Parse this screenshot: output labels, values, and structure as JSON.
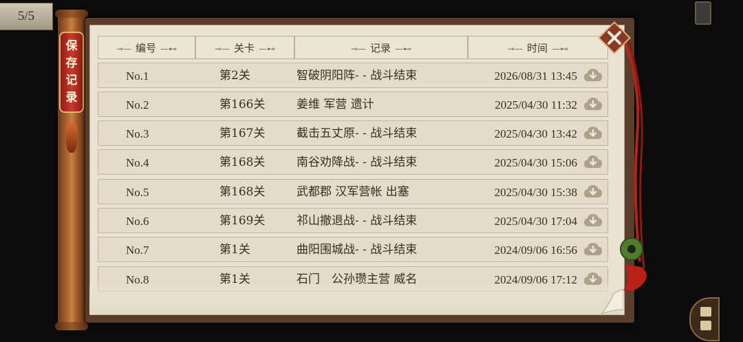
{
  "page_counter": "5/5",
  "side_tab": {
    "chars": [
      "保",
      "存",
      "记",
      "录"
    ]
  },
  "table": {
    "headers": {
      "no": "编号",
      "stage": "关卡",
      "record": "记录",
      "time": "时间"
    },
    "header_ornament_left": "⊸—",
    "header_ornament_right": "—⊷",
    "rows": [
      {
        "no": "No.1",
        "stage": "第2关",
        "record": "智破阴阳阵- - 战斗结束",
        "time": "2026/08/31 13:45"
      },
      {
        "no": "No.2",
        "stage": "第166关",
        "record": "姜维 军营 遗计",
        "time": "2025/04/30 11:32"
      },
      {
        "no": "No.3",
        "stage": "第167关",
        "record": "截击五丈原- - 战斗结束",
        "time": "2025/04/30 13:42"
      },
      {
        "no": "No.4",
        "stage": "第168关",
        "record": "南谷劝降战- - 战斗结束",
        "time": "2025/04/30 15:06"
      },
      {
        "no": "No.5",
        "stage": "第168关",
        "record": "武都郡 汉军营帐 出塞",
        "time": "2025/04/30 15:38"
      },
      {
        "no": "No.6",
        "stage": "第169关",
        "record": "祁山撤退战- - 战斗结束",
        "time": "2025/04/30 17:04"
      },
      {
        "no": "No.7",
        "stage": "第1关",
        "record": "曲阳围城战- - 战斗结束",
        "time": "2024/09/06 16:56"
      },
      {
        "no": "No.8",
        "stage": "第1关",
        "record": "石门　公孙瓒主营 威名",
        "time": "2024/09/06 17:12"
      }
    ]
  },
  "icons": {
    "close": "close-icon",
    "download": "cloud-download-icon",
    "menu": "menu-icon"
  },
  "colors": {
    "panel_bg": "#eae3d3",
    "row_bg": "#e4dccb",
    "frame": "#5a3d2a",
    "tag_red": "#c73a2d",
    "text": "#3a2d22"
  }
}
